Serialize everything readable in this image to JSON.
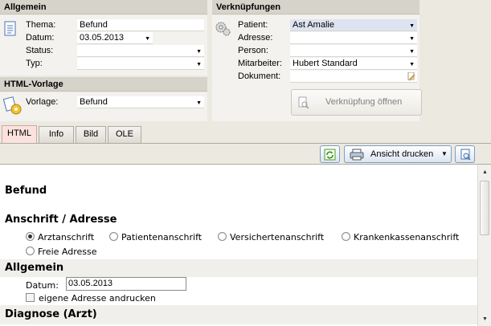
{
  "allgemein": {
    "title": "Allgemein",
    "fields": [
      {
        "label": "Thema:",
        "value": "Befund",
        "dropdown": false
      },
      {
        "label": "Datum:",
        "value": "03.05.2013",
        "dropdown": true
      },
      {
        "label": "Status:",
        "value": "",
        "dropdown": true
      },
      {
        "label": "Typ:",
        "value": "",
        "dropdown": true
      }
    ]
  },
  "vorlage": {
    "title": "HTML-Vorlage",
    "label": "Vorlage:",
    "value": "Befund"
  },
  "verknuepfungen": {
    "title": "Verknüpfungen",
    "fields": [
      {
        "label": "Patient:",
        "value": "Ast Amalie"
      },
      {
        "label": "Adresse:",
        "value": ""
      },
      {
        "label": "Person:",
        "value": ""
      },
      {
        "label": "Mitarbeiter:",
        "value": "Hubert Standard"
      },
      {
        "label": "Dokument:",
        "value": ""
      }
    ],
    "open_button": "Verknüpfung öffnen"
  },
  "tabs": [
    "HTML",
    "Info",
    "Bild",
    "OLE"
  ],
  "active_tab": "HTML",
  "toolbar": {
    "print_label": "Ansicht drucken"
  },
  "document": {
    "heading": "Befund",
    "address_section": "Anschrift / Adresse",
    "address_options": [
      "Arztanschrift",
      "Patientenanschrift",
      "Versichertenanschrift",
      "Krankenkassenanschrift",
      "Freie Adresse"
    ],
    "address_selected": "Arztanschrift",
    "general_section": "Allgemein",
    "date_label": "Datum:",
    "date_value": "03.05.2013",
    "own_address_label": "eigene Adresse andrucken",
    "diagnosis_section": "Diagnose (Arzt)"
  },
  "colors": {
    "active_tab": "#fbe2de",
    "patient_field": "#dde3f0",
    "header": "#d6d3cb"
  }
}
